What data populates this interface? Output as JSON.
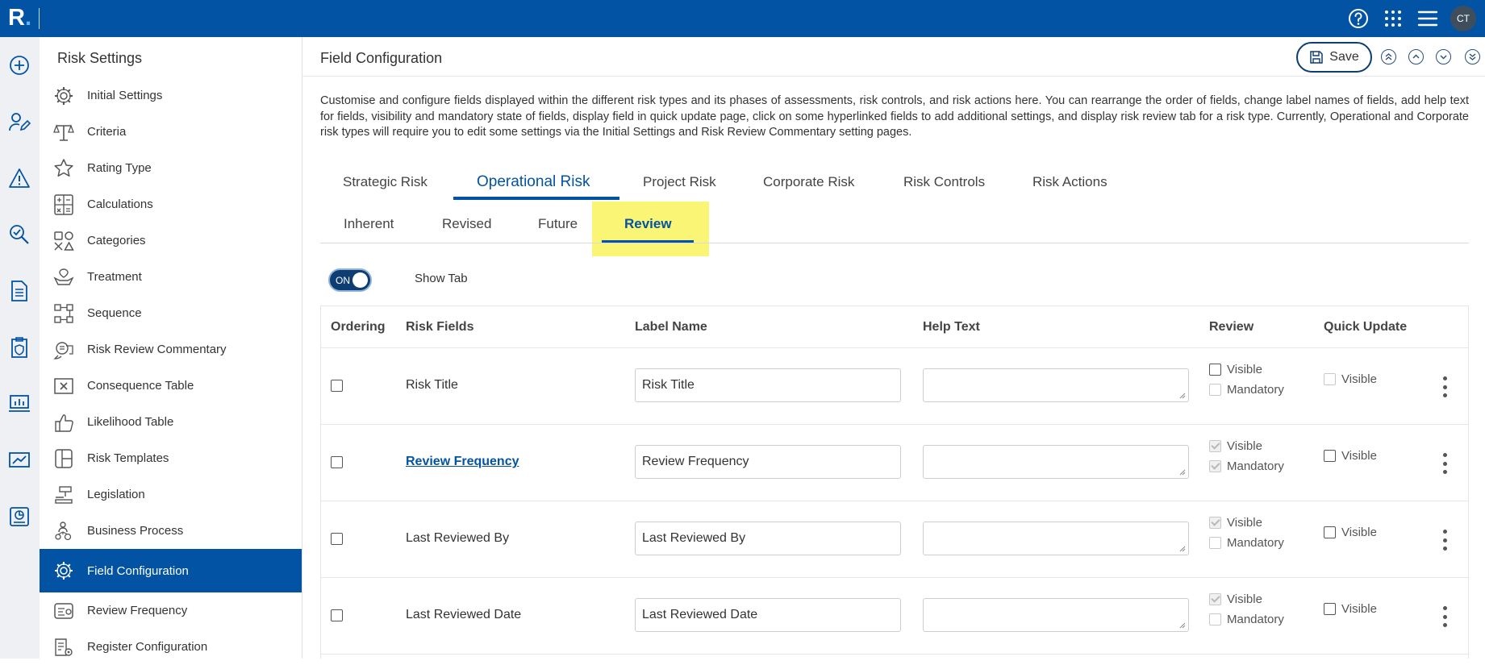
{
  "app": {
    "logo": "R",
    "user_initials": "CT"
  },
  "sidebar": {
    "title": "Risk Settings",
    "items": [
      {
        "label": "Initial Settings",
        "icon": "gear-icon"
      },
      {
        "label": "Criteria",
        "icon": "criteria-icon"
      },
      {
        "label": "Rating Type",
        "icon": "star-icon"
      },
      {
        "label": "Calculations",
        "icon": "calculator-icon"
      },
      {
        "label": "Categories",
        "icon": "categories-icon"
      },
      {
        "label": "Treatment",
        "icon": "treatment-icon"
      },
      {
        "label": "Sequence",
        "icon": "sequence-icon"
      },
      {
        "label": "Risk Review Commentary",
        "icon": "commentary-icon"
      },
      {
        "label": "Consequence Table",
        "icon": "consequence-table-icon"
      },
      {
        "label": "Likelihood Table",
        "icon": "thumbs-up-icon"
      },
      {
        "label": "Risk Templates",
        "icon": "template-icon"
      },
      {
        "label": "Legislation",
        "icon": "gavel-icon"
      },
      {
        "label": "Business Process",
        "icon": "business-process-icon"
      },
      {
        "label": "Field Configuration",
        "icon": "gear-icon",
        "active": true
      },
      {
        "label": "Review Frequency",
        "icon": "review-frequency-icon"
      },
      {
        "label": "Register Configuration",
        "icon": "register-config-icon"
      }
    ]
  },
  "main": {
    "title": "Field Configuration",
    "save_label": "Save",
    "description": "Customise and configure fields displayed within the different risk types and its phases of assessments, risk controls, and risk actions here. You can rearrange the order of fields, change label names of fields, add help text for fields, visibility and mandatory state of fields, display field in quick update page, click on some hyperlinked fields to add additional settings, and display risk review tab for a risk type. Currently, Operational and Corporate risk types will require you to edit some settings via the Initial Settings and Risk Review Commentary setting pages.",
    "tabs": [
      "Strategic Risk",
      "Operational Risk",
      "Project Risk",
      "Corporate Risk",
      "Risk Controls",
      "Risk Actions"
    ],
    "active_tab": "Operational Risk",
    "subtabs": [
      "Inherent",
      "Revised",
      "Future",
      "Review"
    ],
    "active_subtab": "Review",
    "toggle": {
      "state": "ON",
      "label": "Show Tab"
    },
    "table": {
      "headers": [
        "Ordering",
        "Risk Fields",
        "Label Name",
        "Help Text",
        "Review",
        "Quick Update"
      ],
      "rows": [
        {
          "field": "Risk Title",
          "label": "Risk Title",
          "help": "",
          "link": false
        },
        {
          "field": "Review Frequency",
          "label": "Review Frequency",
          "help": "",
          "link": true
        },
        {
          "field": "Last Reviewed By",
          "label": "Last Reviewed By",
          "help": "",
          "link": false
        },
        {
          "field": "Last Reviewed Date",
          "label": "Last Reviewed Date",
          "help": "",
          "link": false
        }
      ],
      "visible_label": "Visible",
      "mandatory_label": "Mandatory"
    }
  },
  "colors": {
    "brand": "#0353a4",
    "highlight": "#fbf575",
    "toggle": "#0d3d72"
  }
}
